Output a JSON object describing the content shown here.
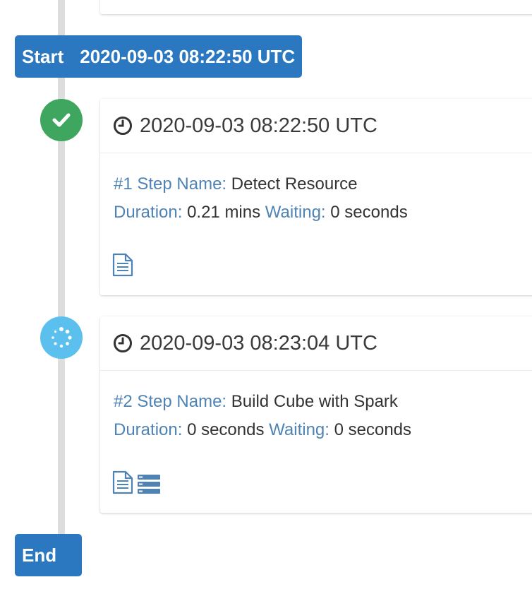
{
  "timeline": {
    "start": {
      "label": "Start",
      "time": "2020-09-03 08:22:50 UTC"
    },
    "end": {
      "label": "End"
    }
  },
  "steps": [
    {
      "status": "success",
      "status_icon": "check-icon",
      "timestamp": "2020-09-03 08:22:50 UTC",
      "number": "#1",
      "step_name_label": "Step Name:",
      "step_name": "Detect Resource",
      "duration_label": "Duration:",
      "duration": "0.21 mins",
      "waiting_label": "Waiting:",
      "waiting": "0 seconds",
      "action_icons": [
        "document-icon"
      ]
    },
    {
      "status": "running",
      "status_icon": "spinner-icon",
      "timestamp": "2020-09-03 08:23:04 UTC",
      "number": "#2",
      "step_name_label": "Step Name:",
      "step_name": "Build Cube with Spark",
      "duration_label": "Duration:",
      "duration": "0 seconds",
      "waiting_label": "Waiting:",
      "waiting": "0 seconds",
      "action_icons": [
        "document-icon",
        "server-icon"
      ]
    }
  ],
  "colors": {
    "badge": "#2b78c1",
    "success": "#3fa65f",
    "running": "#5bc0ee",
    "label": "#4f83b4",
    "timeline": "#dddddd"
  }
}
